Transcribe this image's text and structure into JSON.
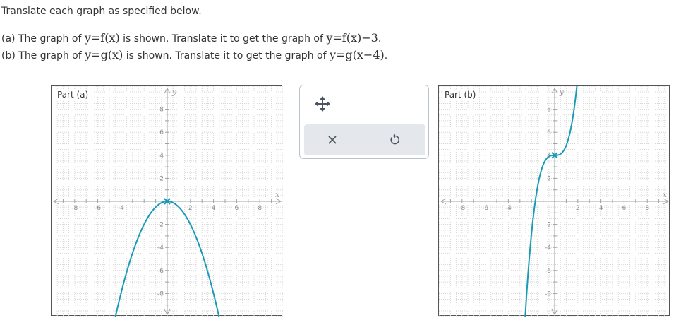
{
  "instructions": "Translate each graph as specified below.",
  "part_a": {
    "prefix": "(a) The graph of ",
    "given_fn": "y=f(x)",
    "middle": " is shown. Translate it to get the graph of ",
    "target_fn": "y=f(x)−3",
    "suffix": "."
  },
  "part_b": {
    "prefix": "(b) The graph of ",
    "given_fn": "y=g(x)",
    "middle": " is shown. Translate it to get the graph of ",
    "target_fn": "y=g(x−4)",
    "suffix": "."
  },
  "graph_a": {
    "label": "Part (a)",
    "x_axis_label": "x",
    "y_axis_label": "y",
    "x_range": [
      -10,
      10
    ],
    "y_range": [
      -10,
      10
    ],
    "x_tick_labels": [
      -8,
      -6,
      -4,
      2,
      4,
      6,
      8
    ],
    "y_tick_labels": [
      8,
      6,
      4,
      2,
      -2,
      -4,
      -6,
      -8
    ],
    "function": "parabola",
    "vertex": [
      0,
      0
    ],
    "coefficient": -0.5,
    "curve_color": "#1a9bb5"
  },
  "graph_b": {
    "label": "Part (b)",
    "x_axis_label": "x",
    "y_axis_label": "y",
    "x_range": [
      -10,
      10
    ],
    "y_range": [
      -10,
      10
    ],
    "x_tick_labels": [
      -8,
      -6,
      -4,
      2,
      4,
      6,
      8
    ],
    "y_tick_labels": [
      8,
      6,
      4,
      2,
      -2,
      -4,
      -6,
      -8
    ],
    "function": "cubic",
    "center": [
      0,
      4
    ],
    "coefficient": 0.85,
    "curve_color": "#1a9bb5"
  },
  "toolbox": {
    "move_icon": "move-arrows-icon",
    "clear_icon": "close-icon",
    "undo_icon": "undo-icon"
  },
  "colors": {
    "accent": "#1a9bb5",
    "grid": "#d6d6d6",
    "axis": "#9aa3aa"
  }
}
